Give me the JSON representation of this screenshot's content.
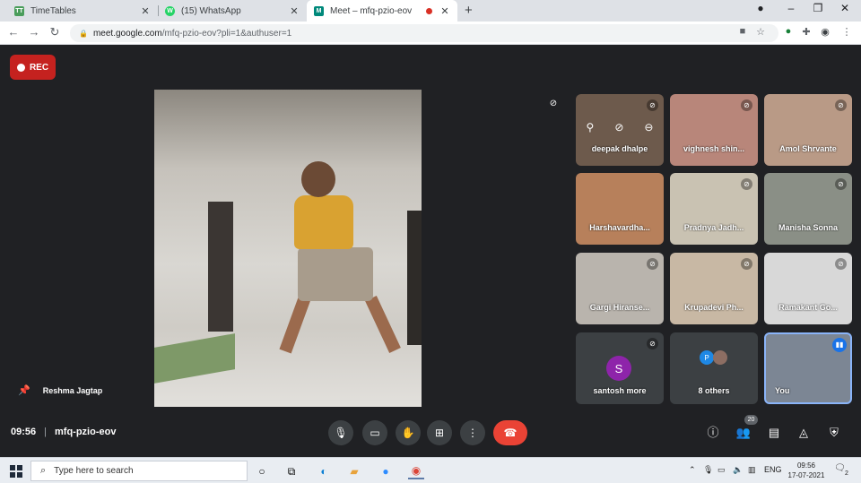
{
  "browser": {
    "tabs": [
      {
        "title": "TimeTables",
        "favicon": "tt-icon",
        "fav_color": "#4a9d5b",
        "fav_text": "TT"
      },
      {
        "title": "(15) WhatsApp",
        "favicon": "whatsapp-icon",
        "fav_color": "#25d366",
        "fav_text": "W"
      },
      {
        "title": "Meet – mfq-pzio-eov",
        "favicon": "meet-icon",
        "fav_color": "#00897b",
        "fav_text": "M"
      }
    ],
    "url_host": "meet.google.com",
    "url_path": "/mfq-pzio-eov?pli=1&authuser=1"
  },
  "meet": {
    "rec_label": "REC",
    "presenter_name": "Reshma Jagtap",
    "time": "09:56",
    "meeting_code": "mfq-pzio-eov",
    "participant_count": "20",
    "tiles": [
      {
        "name": "deepak dhalpe",
        "bg": "#6d5a4c"
      },
      {
        "name": "vighnesh shin...",
        "bg": "#b8867a"
      },
      {
        "name": "Amol Shrvante",
        "bg": "#b99a86"
      },
      {
        "name": "Harshavardha...",
        "bg": "#b7805b"
      },
      {
        "name": "Pradnya Jadh...",
        "bg": "#c9c2b2"
      },
      {
        "name": "Manisha Sonna",
        "bg": "#8a8f86"
      },
      {
        "name": "Gargi Hiranse...",
        "bg": "#b9b4ad"
      },
      {
        "name": "Krupadevi Ph...",
        "bg": "#c8b8a4"
      },
      {
        "name": "Ramakant Go...",
        "bg": "#d8d8d8"
      },
      {
        "name": "santosh more",
        "avatar": "S"
      },
      {
        "name": "8 others",
        "avatar": "P"
      },
      {
        "name": "You",
        "bg": "#7c8694"
      }
    ]
  },
  "taskbar": {
    "search_placeholder": "Type here to search",
    "lang": "ENG",
    "clock_time": "09:56",
    "clock_date": "17-07-2021",
    "notif_count": "2"
  }
}
